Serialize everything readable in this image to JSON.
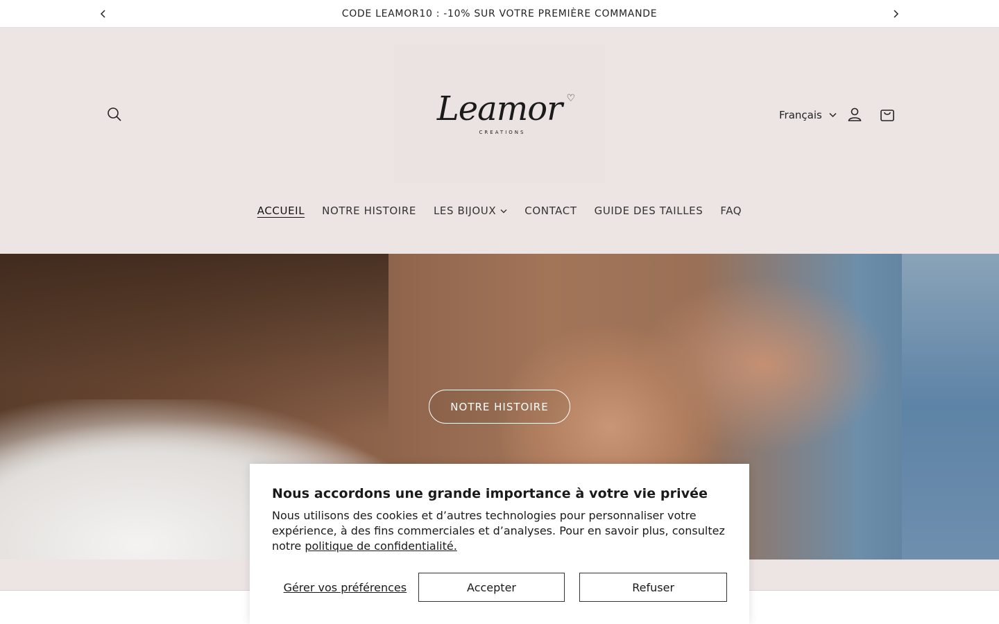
{
  "announcement": {
    "text": "CODE LEAMOR10 : -10% SUR VOTRE PREMIÈRE COMMANDE",
    "prev_icon": "chevron-left-icon",
    "next_icon": "chevron-right-icon"
  },
  "header": {
    "logo_text": "Leamor",
    "logo_subtitle": "CREATIONS",
    "language": "Français",
    "search_icon": "search-icon",
    "account_icon": "user-icon",
    "cart_icon": "bag-icon"
  },
  "nav": {
    "items": [
      {
        "label": "ACCUEIL"
      },
      {
        "label": "NOTRE HISTOIRE"
      },
      {
        "label": "LES BIJOUX"
      },
      {
        "label": "CONTACT"
      },
      {
        "label": "GUIDE DES TAILLES"
      },
      {
        "label": "FAQ"
      }
    ]
  },
  "hero": {
    "cta_label": "NOTRE HISTOIRE"
  },
  "cookie_banner": {
    "title": "Nous accordons une grande importance à votre vie privée",
    "body": "Nous utilisons des cookies et d’autres technologies pour personnaliser votre expérience, à des fins commerciales et d’analyses. Pour en savoir plus, consultez notre ",
    "policy_link": "politique de confidentialité.",
    "preferences_label": "Gérer vos préférences",
    "accept_label": "Accepter",
    "refuse_label": "Refuser"
  },
  "colors": {
    "header_bg": "#ede5e3",
    "text": "#1f1f1f",
    "white": "#ffffff"
  }
}
